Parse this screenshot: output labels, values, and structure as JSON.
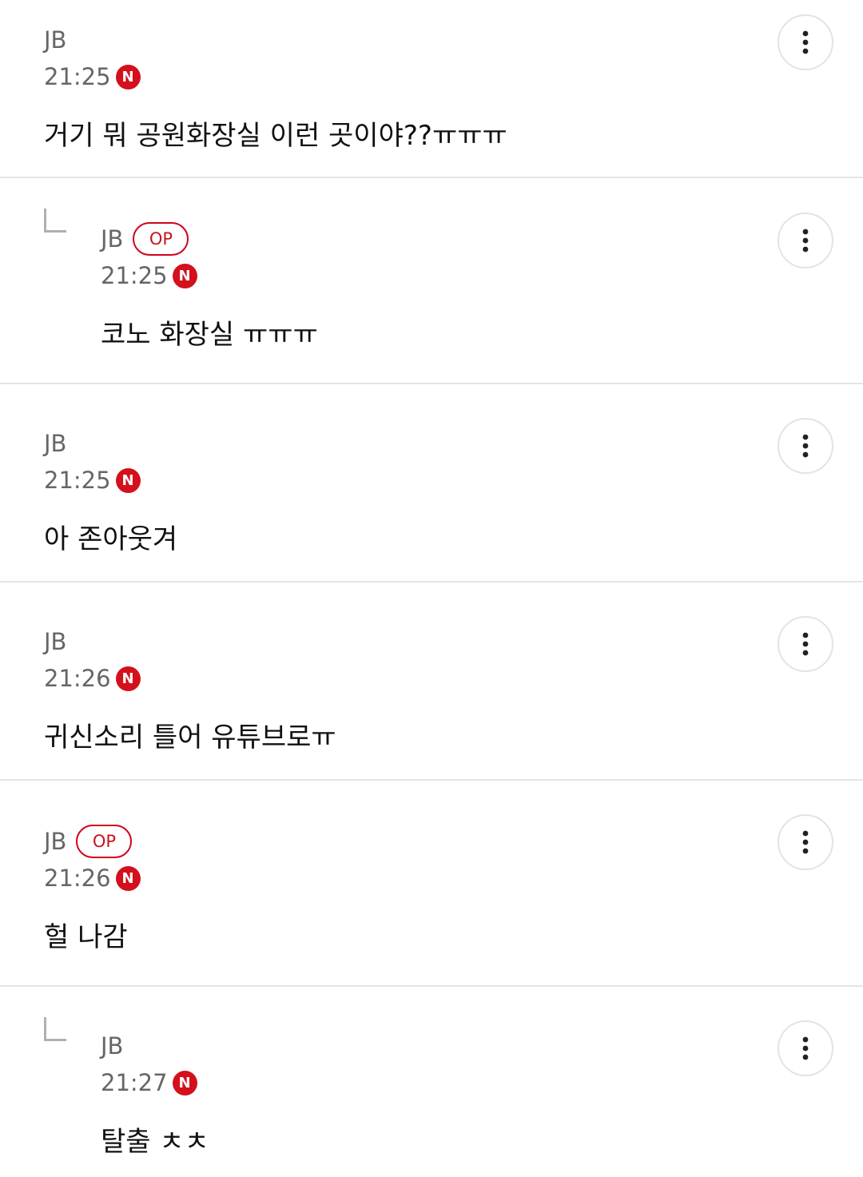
{
  "comments": [
    {
      "author": "JB",
      "op_label": "",
      "time": "21:25",
      "new_label": "N",
      "text": "거기 뭐 공원화장실 이런 곳이야??ㅠㅠㅠ",
      "is_reply": false
    },
    {
      "author": "JB",
      "op_label": "OP",
      "time": "21:25",
      "new_label": "N",
      "text": "코노 화장실 ㅠㅠㅠ",
      "is_reply": true
    },
    {
      "author": "JB",
      "op_label": "",
      "time": "21:25",
      "new_label": "N",
      "text": "아 존아웃겨",
      "is_reply": false
    },
    {
      "author": "JB",
      "op_label": "",
      "time": "21:26",
      "new_label": "N",
      "text": "귀신소리 틀어 유튜브로ㅠ",
      "is_reply": false
    },
    {
      "author": "JB",
      "op_label": "OP",
      "time": "21:26",
      "new_label": "N",
      "text": "헐 나감",
      "is_reply": false
    },
    {
      "author": "JB",
      "op_label": "",
      "time": "21:27",
      "new_label": "N",
      "text": "탈출 ㅊㅊ",
      "is_reply": true
    }
  ],
  "colors": {
    "accent_red": "#d3101c",
    "meta_gray": "#666666",
    "divider": "#e5e5e5"
  },
  "icons": {
    "more": "more-vertical-icon",
    "reply": "reply-corner-icon",
    "new": "new-badge-icon"
  }
}
